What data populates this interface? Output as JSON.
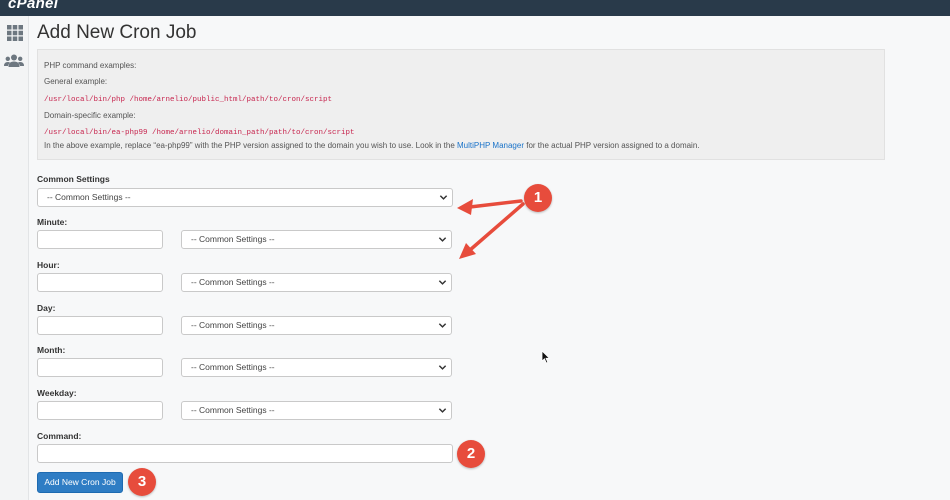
{
  "app": {
    "logo": "cPanel"
  },
  "sidebar": {
    "icons": [
      "grid-icon",
      "users-icon"
    ]
  },
  "page": {
    "title": "Add New Cron Job"
  },
  "info": {
    "heading": "PHP command examples:",
    "general_label": "General example:",
    "general_cmd": "/usr/local/bin/php /home/arnelio/public_html/path/to/cron/script",
    "domain_label": "Domain-specific example:",
    "domain_cmd": "/usr/local/bin/ea-php99 /home/arnelio/domain_path/path/to/cron/script",
    "note_before": "In the above example, replace “ea-php99” with the PHP version assigned to the domain you wish to use. Look in the ",
    "note_link": "MultiPHP Manager",
    "note_after": " for the actual PHP version assigned to a domain."
  },
  "form": {
    "common_settings_label": "Common Settings",
    "common_settings_value": "-- Common Settings --",
    "fields": [
      {
        "label": "Minute:",
        "value": "",
        "select": "-- Common Settings --"
      },
      {
        "label": "Hour:",
        "value": "",
        "select": "-- Common Settings --"
      },
      {
        "label": "Day:",
        "value": "",
        "select": "-- Common Settings --"
      },
      {
        "label": "Month:",
        "value": "",
        "select": "-- Common Settings --"
      },
      {
        "label": "Weekday:",
        "value": "",
        "select": "-- Common Settings --"
      }
    ],
    "command_label": "Command:",
    "command_value": "",
    "submit_label": "Add New Cron Job"
  },
  "annotations": {
    "badges": [
      "1",
      "2",
      "3"
    ],
    "color": "#e74c3c"
  }
}
